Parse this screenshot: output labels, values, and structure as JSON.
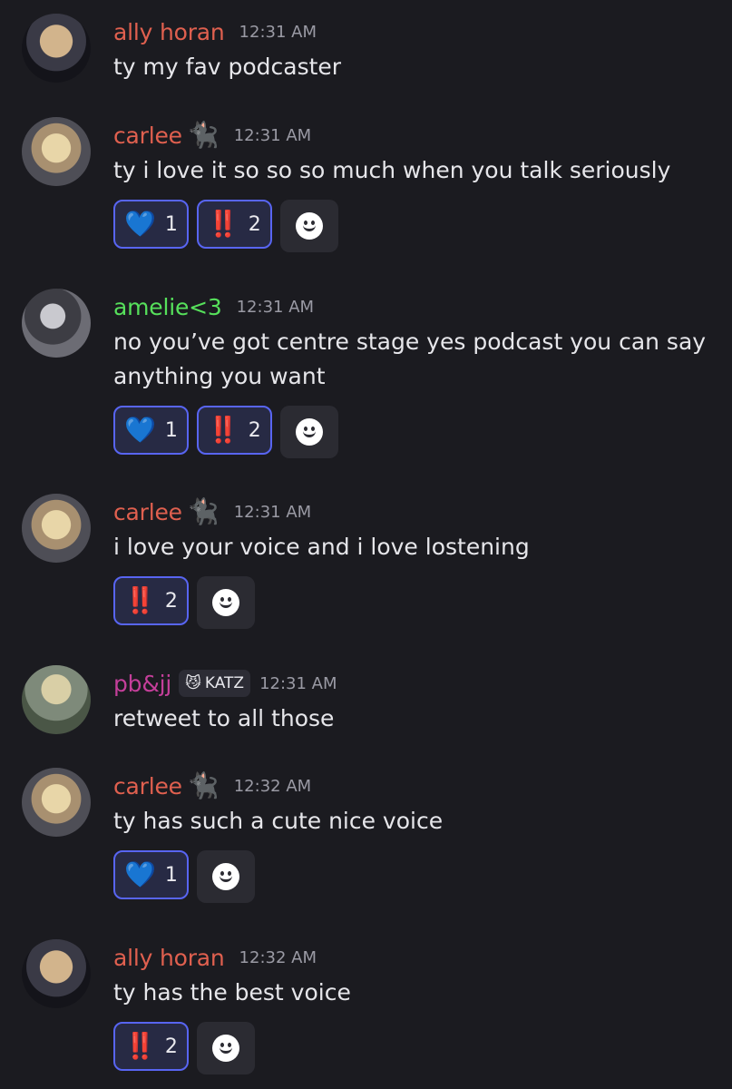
{
  "colors": {
    "background": "#1b1b20",
    "name_red": "#e0604f",
    "name_green": "#56e05b",
    "name_magenta": "#c43f9a",
    "reaction_border": "#5865f2",
    "reaction_bg": "#272a44"
  },
  "messages": [
    {
      "author": "ally horan",
      "time": "12:31 AM",
      "lines": [
        "ty my fav podcaster"
      ],
      "avatar": "ally-avatar"
    },
    {
      "author": "carlee",
      "badge": "🐈‍⬛",
      "time": "12:31 AM",
      "lines": [
        "ty i love it so so so much when you talk seriously"
      ],
      "reactions": [
        {
          "emoji": "💙",
          "count": "1"
        },
        {
          "emoji": "‼️",
          "count": "2"
        }
      ]
    },
    {
      "author": "amelie<3",
      "time": "12:31 AM",
      "lines": [
        "no you’ve got centre stage yes podcast you can say",
        "anything you want"
      ],
      "reactions": [
        {
          "emoji": "💙",
          "count": "1"
        },
        {
          "emoji": "‼️",
          "count": "2"
        }
      ]
    },
    {
      "author": "carlee",
      "badge": "🐈‍⬛",
      "time": "12:31 AM",
      "lines": [
        "i love your voice and i love lostening"
      ],
      "reactions": [
        {
          "emoji": "‼️",
          "count": "2"
        }
      ]
    },
    {
      "author": "pb&jj",
      "tag": {
        "icon": "😼",
        "label": "KATZ"
      },
      "time": "12:31 AM",
      "lines": [
        "retweet to all those"
      ]
    },
    {
      "author": "carlee",
      "badge": "🐈‍⬛",
      "time": "12:32 AM",
      "lines": [
        "ty has such a cute nice voice"
      ],
      "reactions": [
        {
          "emoji": "💙",
          "count": "1"
        }
      ]
    },
    {
      "author": "ally horan",
      "time": "12:32 AM",
      "lines": [
        "ty has the best voice"
      ],
      "reactions": [
        {
          "emoji": "‼️",
          "count": "2"
        }
      ]
    }
  ]
}
